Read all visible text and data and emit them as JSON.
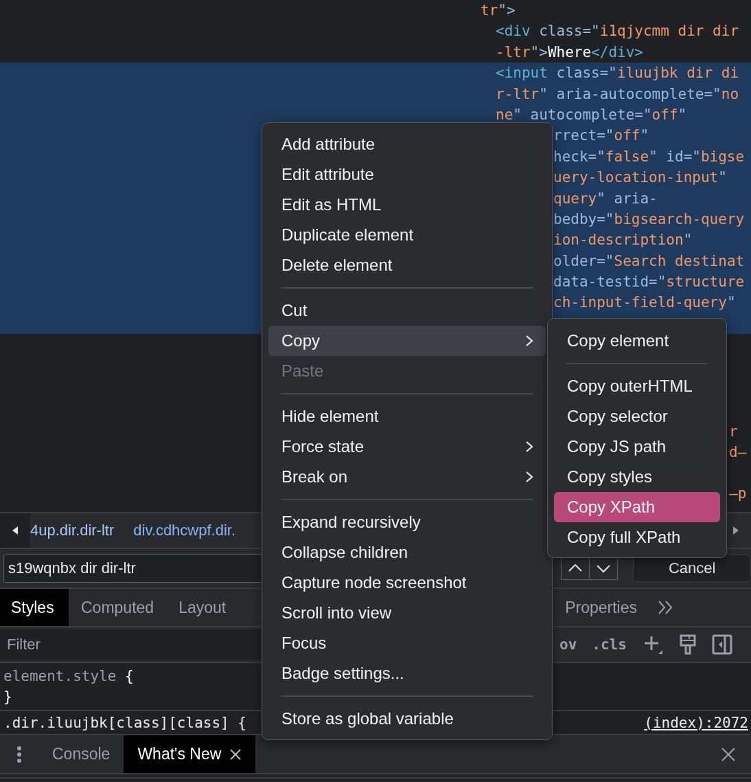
{
  "elements_panel": {
    "lines": [
      {
        "kind": "parent",
        "selected": false,
        "segments": [
          {
            "kind": "value",
            "text": "tr"
          },
          {
            "kind": "punct",
            "text": "\">"
          }
        ]
      },
      {
        "kind": "child",
        "selected": false,
        "segments": [
          {
            "kind": "tag",
            "text": "<div"
          },
          {
            "kind": "attr",
            "text": " class=\""
          },
          {
            "kind": "value",
            "text": "i1qjycmm dir dir"
          }
        ]
      },
      {
        "kind": "child",
        "selected": false,
        "segments": [
          {
            "kind": "value",
            "text": "-ltr"
          },
          {
            "kind": "punct",
            "text": "\">"
          },
          {
            "kind": "text",
            "text": "Where"
          },
          {
            "kind": "tag",
            "text": "</div>"
          }
        ]
      },
      {
        "kind": "child",
        "selected": true,
        "segments": [
          {
            "kind": "tag",
            "text": "<input"
          },
          {
            "kind": "attr",
            "text": " class=\""
          },
          {
            "kind": "value",
            "text": "iluujbk dir di"
          }
        ]
      },
      {
        "kind": "child",
        "selected": true,
        "segments": [
          {
            "kind": "value",
            "text": "r-ltr"
          },
          {
            "kind": "attr",
            "text": "\" aria-autocomplete=\""
          },
          {
            "kind": "value",
            "text": "no"
          }
        ]
      },
      {
        "kind": "child",
        "selected": true,
        "segments": [
          {
            "kind": "value",
            "text": "ne"
          },
          {
            "kind": "attr",
            "text": "\" autocomplete=\""
          },
          {
            "kind": "value",
            "text": "off"
          },
          {
            "kind": "attr",
            "text": "\""
          }
        ]
      },
      {
        "kind": "cut",
        "selected": true,
        "segments": [
          {
            "kind": "attr",
            "text": "rrect=\""
          },
          {
            "kind": "value",
            "text": "off"
          },
          {
            "kind": "attr",
            "text": "\""
          }
        ]
      },
      {
        "kind": "cut",
        "selected": true,
        "segments": [
          {
            "kind": "attr",
            "text": "heck=\""
          },
          {
            "kind": "value",
            "text": "false"
          },
          {
            "kind": "attr",
            "text": "\" id=\""
          },
          {
            "kind": "value",
            "text": "bigse"
          }
        ]
      },
      {
        "kind": "cut",
        "selected": true,
        "segments": [
          {
            "kind": "value",
            "text": "uery-location-input"
          },
          {
            "kind": "attr",
            "text": "\""
          }
        ]
      },
      {
        "kind": "cut",
        "selected": true,
        "segments": [
          {
            "kind": "value",
            "text": "query"
          },
          {
            "kind": "attr",
            "text": "\" aria-"
          }
        ]
      },
      {
        "kind": "cut",
        "selected": true,
        "segments": [
          {
            "kind": "attr",
            "text": "bedby=\""
          },
          {
            "kind": "value",
            "text": "bigsearch-query"
          }
        ]
      },
      {
        "kind": "cut",
        "selected": true,
        "segments": [
          {
            "kind": "value",
            "text": "ion-description"
          },
          {
            "kind": "attr",
            "text": "\""
          }
        ]
      },
      {
        "kind": "cut",
        "selected": true,
        "segments": [
          {
            "kind": "attr",
            "text": "older=\""
          },
          {
            "kind": "value",
            "text": "Search destinat"
          }
        ]
      },
      {
        "kind": "cut",
        "selected": true,
        "segments": [
          {
            "kind": "attr",
            "text": "data-testid=\""
          },
          {
            "kind": "value",
            "text": "structure"
          }
        ]
      },
      {
        "kind": "cut",
        "selected": true,
        "segments": [
          {
            "kind": "value",
            "text": "ch-input-field-query"
          },
          {
            "kind": "attr",
            "text": "\""
          }
        ]
      }
    ],
    "edge_fragments": [
      "r",
      "d–",
      "–p"
    ]
  },
  "breadcrumbs": [
    "4up.dir.dir-ltr",
    "div.cdhcwpf.dir."
  ],
  "search": {
    "value": "s19wqnbx dir dir-ltr",
    "cancel_label": "Cancel"
  },
  "sidebar_tabs": [
    {
      "label": "Styles",
      "selected": true
    },
    {
      "label": "Computed",
      "selected": false
    },
    {
      "label": "Layout",
      "selected": false
    },
    {
      "label": "Properties",
      "selected": false
    }
  ],
  "styles_toolbar": {
    "filter_placeholder": "Filter",
    "hov_label": "ov",
    "cls_label": ".cls"
  },
  "styles": {
    "element_style": {
      "selector": "element.style",
      "open": "{",
      "close": "}"
    },
    "rule": {
      "selector": ".dir.iluujbk[class][class]",
      "open": "{",
      "source": "(index):2072"
    }
  },
  "drawer_tabs": [
    {
      "label": "Console",
      "selected": false,
      "closable": false
    },
    {
      "label": "What's New",
      "selected": true,
      "closable": true
    }
  ],
  "context_menu": {
    "items": [
      {
        "kind": "item",
        "label": "Add attribute",
        "selected": false,
        "disabled": false,
        "submenu": false
      },
      {
        "kind": "item",
        "label": "Edit attribute",
        "selected": false,
        "disabled": false,
        "submenu": false
      },
      {
        "kind": "item",
        "label": "Edit as HTML",
        "selected": false,
        "disabled": false,
        "submenu": false
      },
      {
        "kind": "item",
        "label": "Duplicate element",
        "selected": false,
        "disabled": false,
        "submenu": false
      },
      {
        "kind": "item",
        "label": "Delete element",
        "selected": false,
        "disabled": false,
        "submenu": false
      },
      {
        "kind": "separator"
      },
      {
        "kind": "item",
        "label": "Cut",
        "selected": false,
        "disabled": false,
        "submenu": false
      },
      {
        "kind": "item",
        "label": "Copy",
        "selected": true,
        "disabled": false,
        "submenu": true
      },
      {
        "kind": "item",
        "label": "Paste",
        "selected": false,
        "disabled": true,
        "submenu": false
      },
      {
        "kind": "separator"
      },
      {
        "kind": "item",
        "label": "Hide element",
        "selected": false,
        "disabled": false,
        "submenu": false
      },
      {
        "kind": "item",
        "label": "Force state",
        "selected": false,
        "disabled": false,
        "submenu": true
      },
      {
        "kind": "item",
        "label": "Break on",
        "selected": false,
        "disabled": false,
        "submenu": true
      },
      {
        "kind": "separator"
      },
      {
        "kind": "item",
        "label": "Expand recursively",
        "selected": false,
        "disabled": false,
        "submenu": false
      },
      {
        "kind": "item",
        "label": "Collapse children",
        "selected": false,
        "disabled": false,
        "submenu": false
      },
      {
        "kind": "item",
        "label": "Capture node screenshot",
        "selected": false,
        "disabled": false,
        "submenu": false
      },
      {
        "kind": "item",
        "label": "Scroll into view",
        "selected": false,
        "disabled": false,
        "submenu": false
      },
      {
        "kind": "item",
        "label": "Focus",
        "selected": false,
        "disabled": false,
        "submenu": false
      },
      {
        "kind": "item",
        "label": "Badge settings...",
        "selected": false,
        "disabled": false,
        "submenu": false
      },
      {
        "kind": "separator"
      },
      {
        "kind": "item",
        "label": "Store as global variable",
        "selected": false,
        "disabled": false,
        "submenu": false
      }
    ]
  },
  "copy_submenu": {
    "items": [
      {
        "kind": "item",
        "label": "Copy element",
        "selected": false
      },
      {
        "kind": "separator"
      },
      {
        "kind": "item",
        "label": "Copy outerHTML",
        "selected": false
      },
      {
        "kind": "item",
        "label": "Copy selector",
        "selected": false
      },
      {
        "kind": "item",
        "label": "Copy JS path",
        "selected": false
      },
      {
        "kind": "item",
        "label": "Copy styles",
        "selected": false
      },
      {
        "kind": "item",
        "label": "Copy XPath",
        "selected": true
      },
      {
        "kind": "item",
        "label": "Copy full XPath",
        "selected": false
      }
    ]
  }
}
